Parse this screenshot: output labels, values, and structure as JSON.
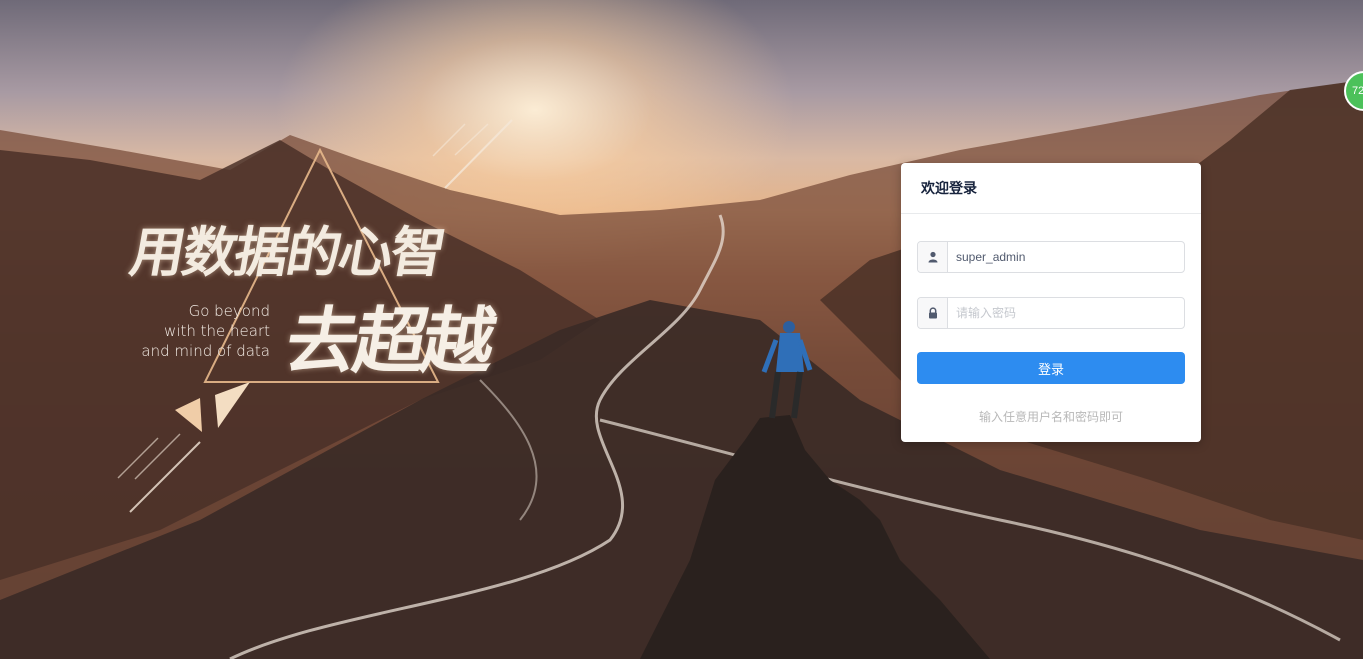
{
  "background": {
    "slogan_cn_line1": "用数据的心智",
    "slogan_cn_line2": "去超越",
    "slogan_en": [
      "Go beyond",
      "with the heart",
      "and mind of data"
    ]
  },
  "login": {
    "title": "欢迎登录",
    "username_value": "super_admin",
    "username_icon": "user-icon",
    "password_placeholder": "请输入密码",
    "password_icon": "lock-icon",
    "submit_label": "登录",
    "hint": "输入任意用户名和密码即可",
    "accent_color": "#2d8cf0"
  },
  "badge": {
    "text": "72"
  }
}
